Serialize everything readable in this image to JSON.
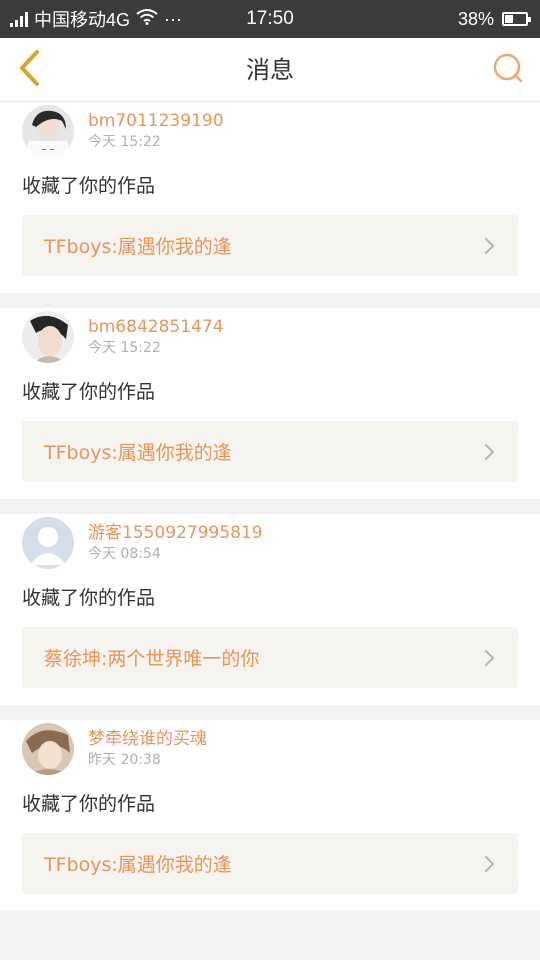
{
  "status_bar": {
    "carrier": "中国移动4G",
    "dots": "···",
    "time": "17:50",
    "battery_percent": "38%",
    "battery_level": 0.38,
    "icons": [
      "signal-icon",
      "wifi-icon",
      "battery-icon"
    ]
  },
  "nav": {
    "title": "消息",
    "back_icon": "back-chevron-icon",
    "search_icon": "search-icon"
  },
  "colors": {
    "accent": "#e8945b",
    "back_icon": "#d4a52a",
    "status_bar_bg": "#3b3b3b",
    "page_bg": "#f2f2f2",
    "work_bg": "#f5f4ef"
  },
  "messages": [
    {
      "username": "bm7011239190",
      "time": "今天 15:22",
      "action": "收藏了你的作品",
      "work_title": "TFboys:属遇你我的逢",
      "avatar": "avatar-photo"
    },
    {
      "username": "bm6842851474",
      "time": "今天 15:22",
      "action": "收藏了你的作品",
      "work_title": "TFboys:属遇你我的逢",
      "avatar": "avatar-photo"
    },
    {
      "username": "游客1550927995819",
      "time": "今天 08:54",
      "action": "收藏了你的作品",
      "work_title": "蔡徐坤:两个世界唯一的你",
      "avatar": "default-avatar"
    },
    {
      "username": "梦牵绕谁的买魂",
      "time": "昨天 20:38",
      "action": "收藏了你的作品",
      "work_title": "TFboys:属遇你我的逢",
      "avatar": "avatar-photo"
    }
  ]
}
